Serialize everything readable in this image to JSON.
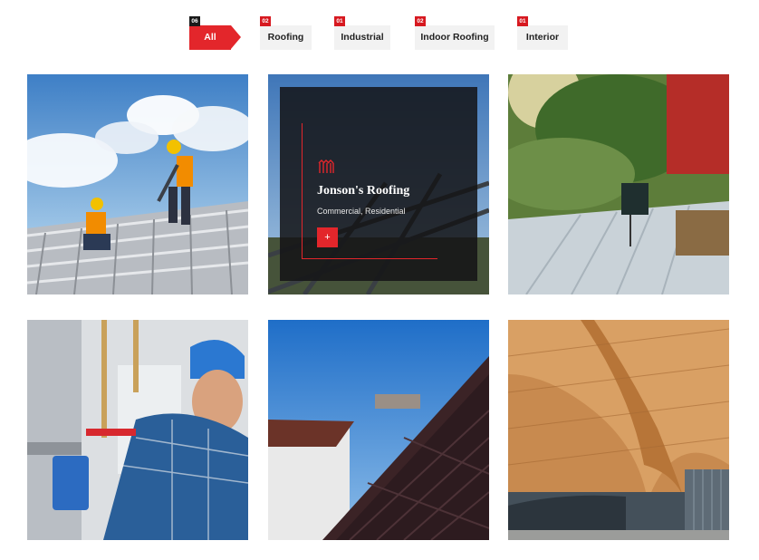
{
  "filters": [
    {
      "label": "All",
      "count": "06",
      "active": true
    },
    {
      "label": "Roofing",
      "count": "02",
      "active": false
    },
    {
      "label": "Industrial",
      "count": "01",
      "active": false
    },
    {
      "label": "Indoor Roofing",
      "count": "02",
      "active": false
    },
    {
      "label": "Interior",
      "count": "01",
      "active": false
    }
  ],
  "projects": [
    {
      "image": "workers-on-roof-frame-photo"
    },
    {
      "image": "roof-structure-photo",
      "title": "Jonson's Roofing",
      "categories": "Commercial, Residential",
      "button_label": "+",
      "icon": "columns-icon"
    },
    {
      "image": "drilling-metal-roof-photo"
    },
    {
      "image": "plumber-fixing-pipes-photo"
    },
    {
      "image": "dark-tiled-roof-photo"
    },
    {
      "image": "wooden-curved-ceiling-photo"
    }
  ],
  "colors": {
    "accent": "#e3262b",
    "dark": "#1a1a1a",
    "filter_bg": "#f2f2f2"
  }
}
